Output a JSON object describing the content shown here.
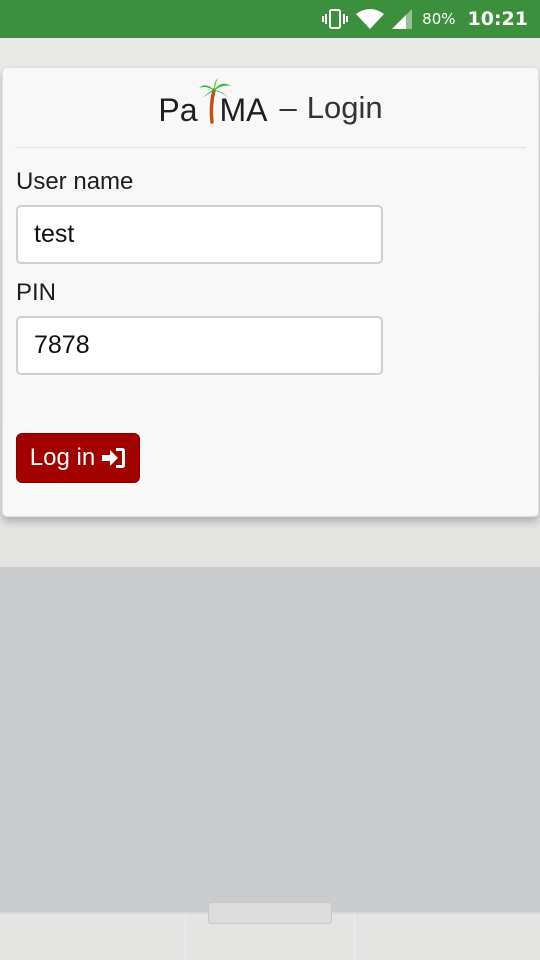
{
  "status_bar": {
    "battery_percent": "80%",
    "clock": "10:21",
    "icons": [
      "vibrate-icon",
      "wifi-icon",
      "signal-icon"
    ],
    "background_color": "#3b8f3d"
  },
  "card": {
    "logo": {
      "prefix": "Pa",
      "suffix": "MA",
      "icon": "palm-tree-icon"
    },
    "dash": "–",
    "title": "Login",
    "username": {
      "label": "User name",
      "value": "test"
    },
    "pin": {
      "label": "PIN",
      "value": "7878"
    },
    "login_button": {
      "label": "Log in",
      "icon": "sign-in-icon",
      "color": "#a30000"
    }
  }
}
